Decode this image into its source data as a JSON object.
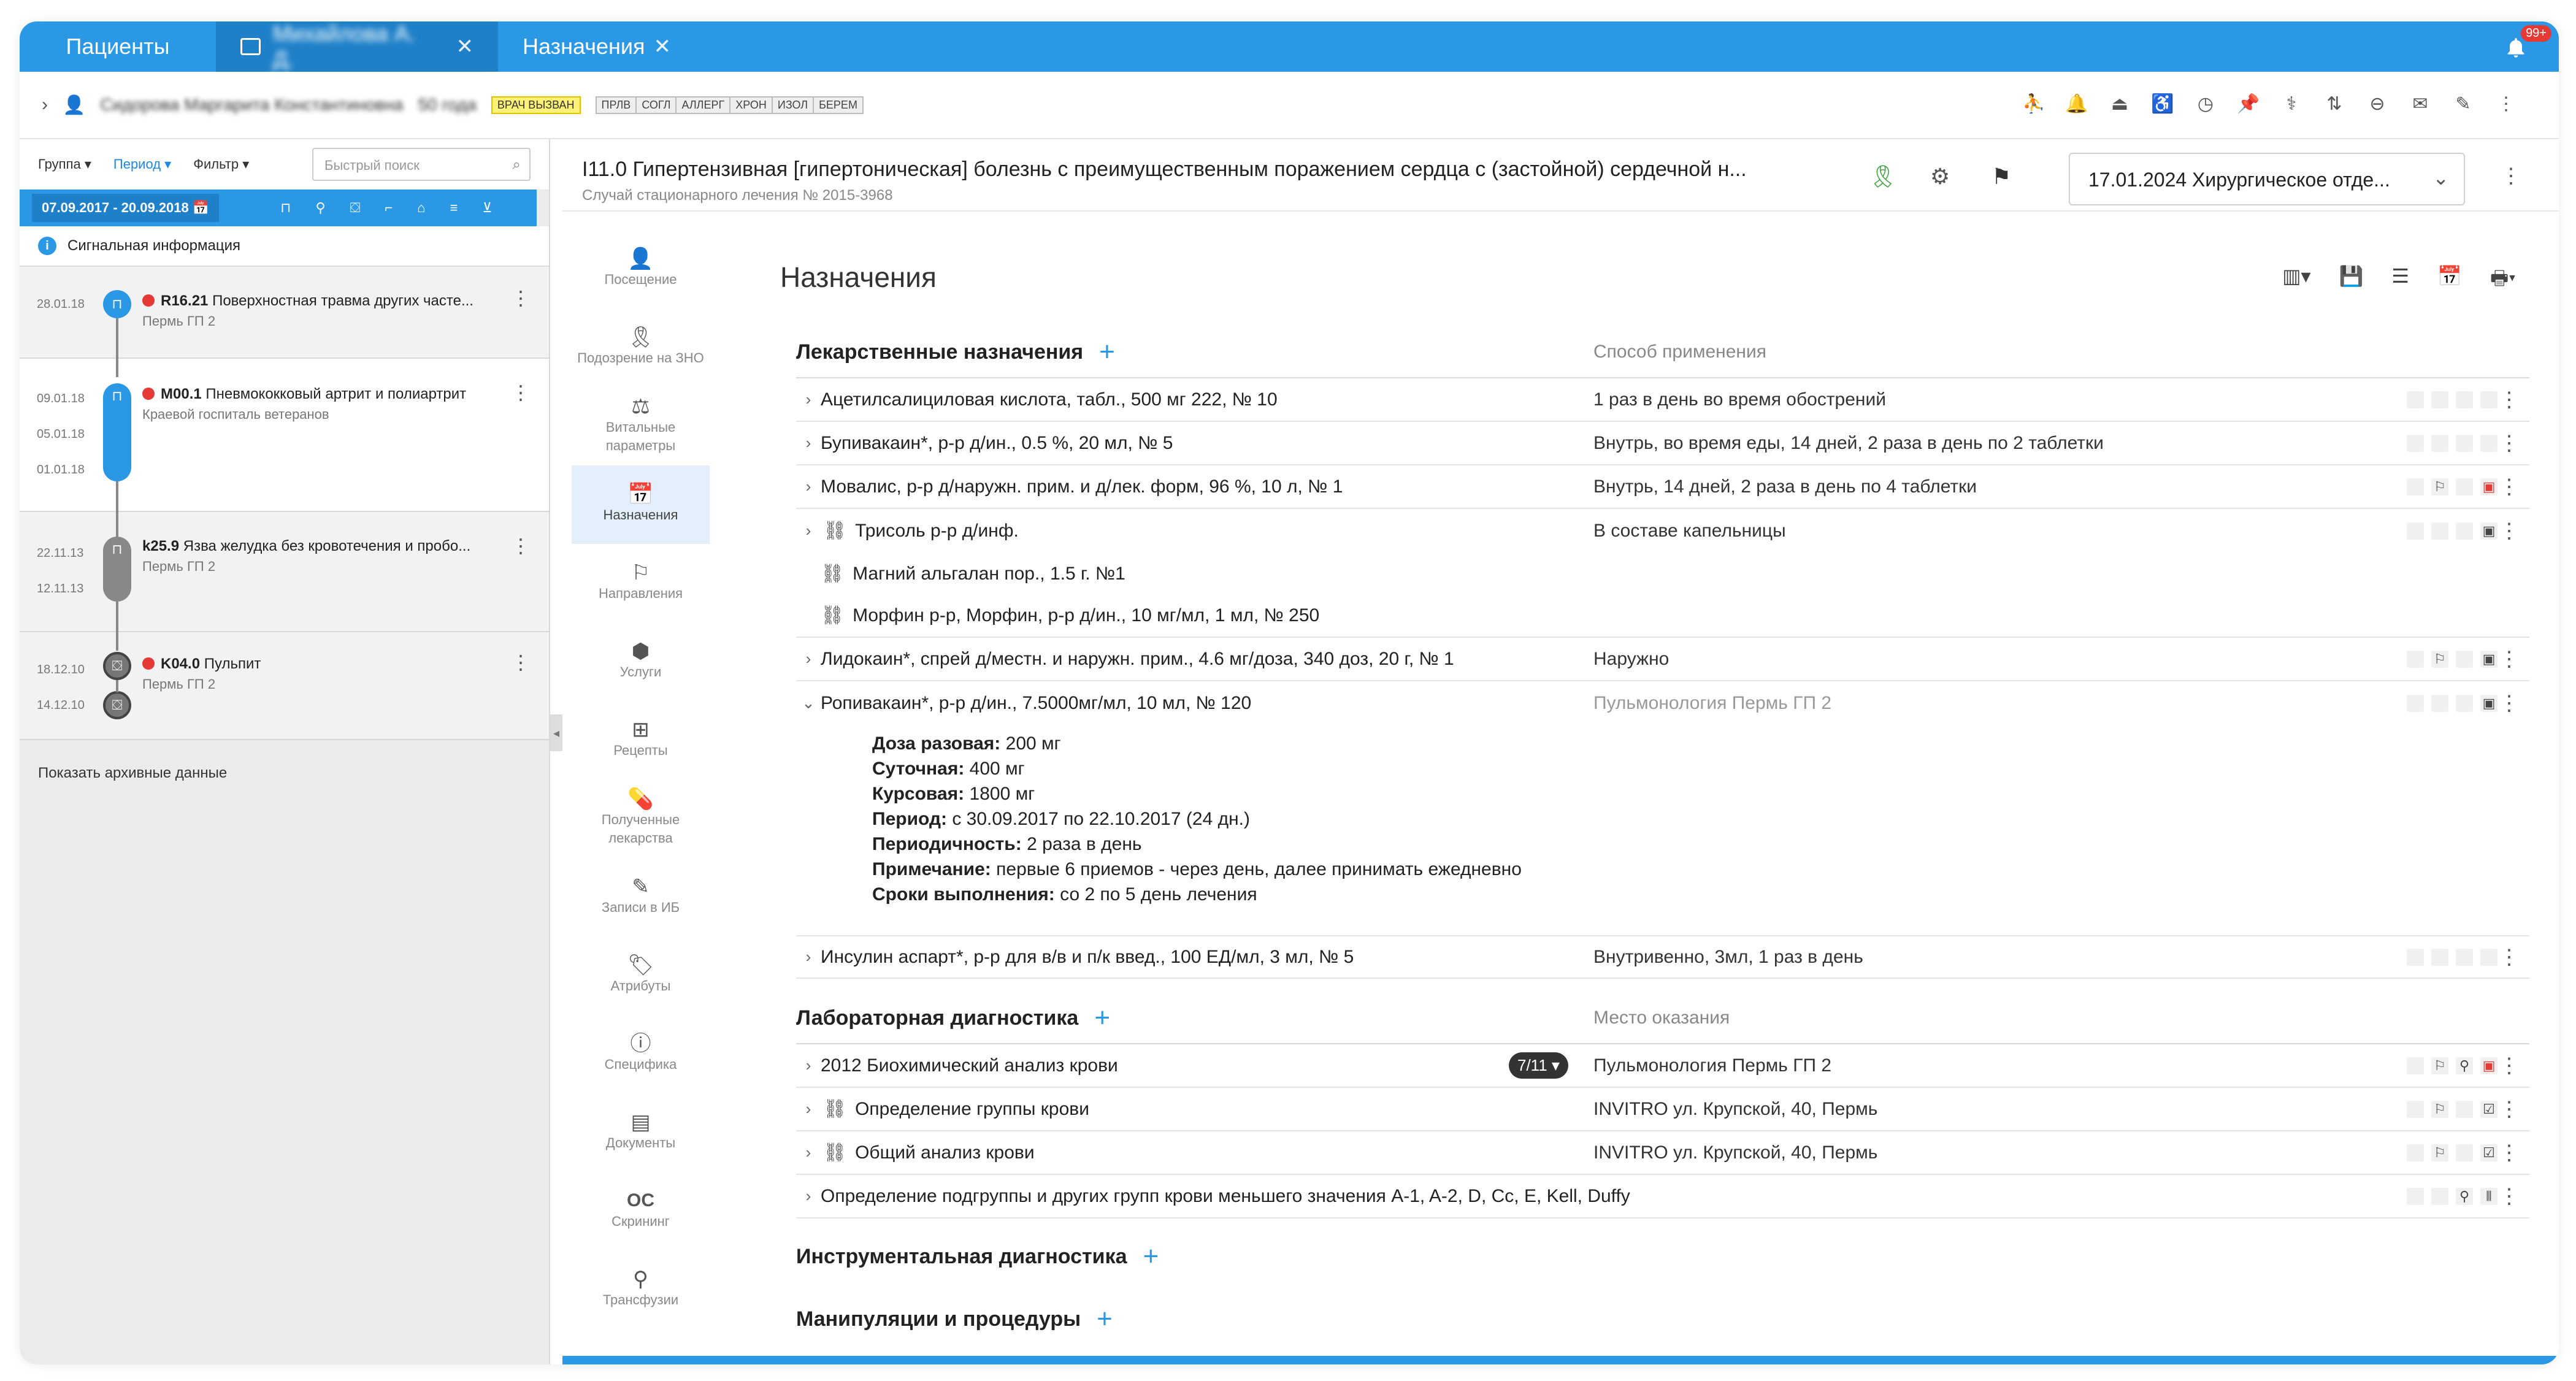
{
  "tabs": {
    "patients": "Пациенты",
    "patient_name": "Михайлова А. Д.",
    "assignments": "Назначения",
    "notif_count": "99+"
  },
  "patient": {
    "name": "Сидорова Маргарита Константиновна",
    "age": "50 года",
    "doctor_called": "ВРАЧ ВЫЗВАН",
    "tags": [
      "ПРЛВ",
      "СОГЛ",
      "АЛЛЕРГ",
      "ХРОН",
      "ИЗОЛ",
      "БЕРЕМ"
    ]
  },
  "left": {
    "group": "Группа",
    "period": "Период",
    "filter": "Фильтр",
    "search_placeholder": "Быстрый поиск",
    "range": "07.09.2017 - 20.09.2018",
    "signal": "Сигнальная информация",
    "episodes": [
      {
        "dates": [
          "28.01.18"
        ],
        "code": "R16.21",
        "name": "Поверхностная травма других часте...",
        "place": "Пермь ГП 2"
      },
      {
        "dates": [
          "09.01.18",
          "05.01.18",
          "01.01.18"
        ],
        "code": "M00.1",
        "name": "Пневмококковый артрит и полиартрит",
        "place": "Краевой госпиталь ветеранов"
      },
      {
        "dates": [
          "22.11.13",
          "12.11.13"
        ],
        "code": "k25.9",
        "name": "Язва желудка без кровотечения и пробо...",
        "place": "Пермь ГП 2"
      },
      {
        "dates": [
          "18.12.10",
          "14.12.10"
        ],
        "code": "K04.0",
        "name": "Пульпит",
        "place": "Пермь ГП 2"
      }
    ],
    "archive": "Показать архивные данные"
  },
  "case": {
    "title": "I11.0 Гипертензивная [гипертоническая] болезнь с преимущественным поражением сердца с (застойной) сердечной н...",
    "subtitle": "Случай стационарного лечения № 2015-3968",
    "dept": "17.01.2024 Хирургическое отде..."
  },
  "rail": [
    {
      "icon": "visit-icon",
      "label": "Посещение"
    },
    {
      "icon": "ribbon-icon",
      "label": "Подозрение на ЗНО"
    },
    {
      "icon": "vitals-icon",
      "label": "Витальные параметры"
    },
    {
      "icon": "calendar-icon",
      "label": "Назначения"
    },
    {
      "icon": "signpost-icon",
      "label": "Направления"
    },
    {
      "icon": "services-icon",
      "label": "Услуги"
    },
    {
      "icon": "recipe-icon",
      "label": "Рецепты"
    },
    {
      "icon": "pill-icon",
      "label": "Полученные лекарства"
    },
    {
      "icon": "edit-doc-icon",
      "label": "Записи в ИБ"
    },
    {
      "icon": "tag-icon",
      "label": "Атрибуты"
    },
    {
      "icon": "alert-icon",
      "label": "Специфика"
    },
    {
      "icon": "documents-icon",
      "label": "Документы"
    },
    {
      "icon": "os-icon",
      "label": "Скрининг"
    },
    {
      "icon": "transfusion-icon",
      "label": "Трансфузии"
    }
  ],
  "main": {
    "title": "Назначения",
    "drugs_header": "Лекарственные назначения",
    "drugs_col2": "Способ применения",
    "drugs": [
      {
        "name": "Ацетилсалициловая кислота, табл., 500 мг 222, № 10",
        "use": "1 раз в день во время обострений"
      },
      {
        "name": "Бупивакаин*, р-р д/ин., 0.5 %, 20 мл, № 5",
        "use": "Внутрь, во время еды, 14 дней, 2 раза в день по 2 таблетки"
      },
      {
        "name": "Мовалис, р-р д/наружн. прим. и д/лек. форм, 96 %, 10 л, № 1",
        "use": "Внутрь, 14 дней, 2 раза в день по 4 таблетки"
      },
      {
        "name": "Трисоль р-р д/инф.",
        "use": "В составе капельницы"
      },
      {
        "name": "Магний альгалан пор., 1.5 г. №1",
        "use": ""
      },
      {
        "name": "Морфин р-р, Морфин, р-р д/ин., 10 мг/мл, 1 мл, № 250",
        "use": ""
      },
      {
        "name": "Лидокаин*, спрей д/местн. и наружн. прим., 4.6 мг/доза, 340 доз, 20 г, № 1",
        "use": "Наружно"
      },
      {
        "name": "Ропивакаин*, р-р д/ин., 7.5000мг/мл, 10 мл, № 120",
        "use": "Пульмонология Пермь ГП 2"
      },
      {
        "name": "Инсулин аспарт*, р-р для в/в и п/к введ., 100 ЕД/мл, 3 мл, № 5",
        "use": "Внутривенно, 3мл, 1 раз в день"
      }
    ],
    "detail": {
      "dose_l": "Доза разовая:",
      "dose": "200 мг",
      "daily_l": "Суточная:",
      "daily": "400 мг",
      "course_l": "Курсовая:",
      "course": "1800 мг",
      "period_l": "Период:",
      "period": "с 30.09.2017 по 22.10.2017 (24 дн.)",
      "freq_l": "Периодичность:",
      "freq": "2 раза в день",
      "note_l": "Примечание:",
      "note": "первые 6 приемов - через день, далее принимать ежедневно",
      "term_l": "Сроки выполнения:",
      "term": "со 2 по 5 день лечения"
    },
    "lab_header": "Лабораторная диагностика",
    "lab_col2": "Место оказания",
    "labs": [
      {
        "name": "2012 Биохимический анализ крови",
        "badge": "7/11",
        "place": "Пульмонология Пермь ГП 2"
      },
      {
        "name": "Определение группы крови",
        "place": "INVITRO ул. Крупской, 40, Пермь"
      },
      {
        "name": "Общий анализ крови",
        "place": "INVITRO ул. Крупской, 40, Пермь"
      },
      {
        "name": "Определение подгруппы и других групп крови меньшего значения A-1, A-2, D, Cc, E, Kell, Duffy",
        "place": ""
      }
    ],
    "instr_header": "Инструментальная диагностика",
    "manip_header": "Манипуляции и процедуры"
  },
  "colors": {
    "accent": "#2b98e6",
    "accent_dark": "#1e80c8",
    "alert": "#e53935",
    "ok": "#2e9d2e"
  }
}
